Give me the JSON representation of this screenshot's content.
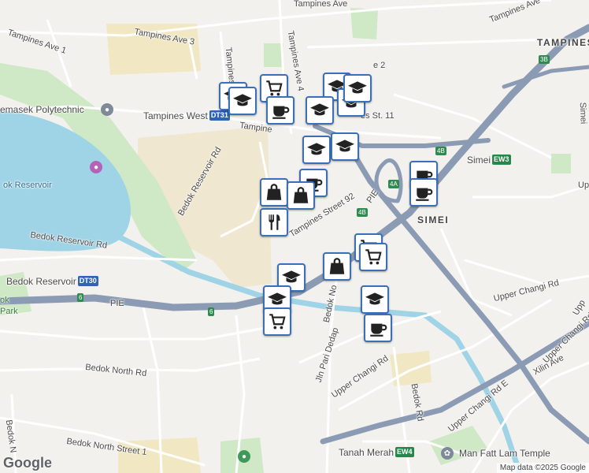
{
  "roads": {
    "tampines_ave_top": "Tampines Ave",
    "tampines_ave_3": "Tampines Ave 3",
    "tampines_ave_1": "Tampines Ave 1",
    "tampines_ave_2_partial": "e 2",
    "tampines_ave_4": "Tampines Ave 4",
    "tampines_ave_right": "Tampines Ave",
    "tampines_west_rd": "Tampines",
    "tampines_road": "Tampine",
    "tampines_st_11": "es St. 11",
    "tampines_st_92": "Tampines Street 92",
    "bedok_reservoir_rd_v": "Bedok Reservoir Rd",
    "bedok_reservoir_rd_h": "Bedok Reservoir Rd",
    "pie_west": "PIE",
    "pie_mid": "PIE",
    "bedok_north_ave": "Bedok No",
    "jln_pari_dedap": "Jln Pari Dedap",
    "upper_changi_rd": "Upper Changi Rd",
    "upper_changi_rd_east": "Upper Changi Rd",
    "upper_changi_rd_e": "Upper Changi Rd E",
    "upper_changi_rd_e_2": "Upper Changi Rd E",
    "xilin_ave": "Xilin Ave",
    "bedok_north_rd": "Bedok North Rd",
    "bedok_north_st_1": "Bedok North Street 1",
    "bedok_rd": "Bedok Rd",
    "bedok_n_left": "Bedok N",
    "simei_partial": "Simei",
    "upp_partial": "Upp",
    "upp_right": "Upp"
  },
  "places": {
    "temasek_poly": "emasek Polytechnic",
    "bedok_reservoir": "ok Reservoir",
    "tampines_area": "TAMPINES",
    "simei_area": "SIMEI",
    "park_partial_1": "ok",
    "park_partial_2": "Park",
    "man_fatt_lam": "Man Fatt Lam Temple"
  },
  "stations": {
    "tampines_west": {
      "name": "Tampines West",
      "code": "DT31"
    },
    "bedok_reservoir": {
      "name": "Bedok Reservoir",
      "code": "DT30"
    },
    "simei": {
      "name": "Simei",
      "code": "EW3"
    },
    "tanah_merah": {
      "name": "Tanah Merah",
      "code": "EW4"
    }
  },
  "exits": [
    "4A",
    "4B",
    "4B",
    "3B",
    "6",
    "6"
  ],
  "markers": [
    {
      "icon": "cart"
    },
    {
      "icon": "school"
    },
    {
      "icon": "school"
    },
    {
      "icon": "school"
    },
    {
      "icon": "cup"
    },
    {
      "icon": "school"
    },
    {
      "icon": "school"
    },
    {
      "icon": "school"
    },
    {
      "icon": "school"
    },
    {
      "icon": "school"
    },
    {
      "icon": "cup"
    },
    {
      "icon": "bag"
    },
    {
      "icon": "bag"
    },
    {
      "icon": "food"
    },
    {
      "icon": "cup"
    },
    {
      "icon": "cup"
    },
    {
      "icon": "school"
    },
    {
      "icon": "school"
    },
    {
      "icon": "cart"
    },
    {
      "icon": "bag"
    },
    {
      "icon": "cart"
    },
    {
      "icon": "cart"
    },
    {
      "icon": "school"
    },
    {
      "icon": "cup"
    }
  ],
  "branding": {
    "logo": "Google",
    "attribution": "Map data ©2025 Google"
  },
  "colors": {
    "marker_border": "#3b6fb6",
    "water": "#9fd3e6",
    "expressway": "#8b9bb4",
    "park": "#cfe8c5"
  }
}
